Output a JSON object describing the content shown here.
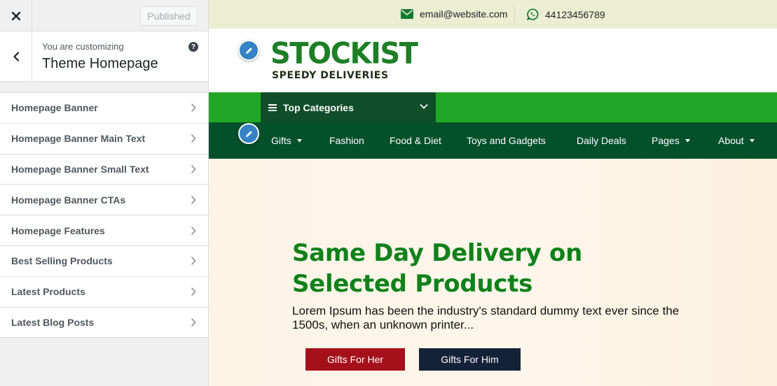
{
  "sidebar": {
    "close_icon": "close-icon",
    "publish_label": "Published",
    "info": {
      "customizing_label": "You are customizing",
      "title": "Theme Homepage",
      "help_label": "?"
    },
    "items": [
      {
        "label": "Homepage Banner"
      },
      {
        "label": "Homepage Banner Main Text"
      },
      {
        "label": "Homepage Banner Small Text"
      },
      {
        "label": "Homepage Banner CTAs"
      },
      {
        "label": "Homepage Features"
      },
      {
        "label": "Best Selling Products"
      },
      {
        "label": "Latest Products"
      },
      {
        "label": "Latest Blog Posts"
      }
    ]
  },
  "preview": {
    "topbar": {
      "email": "email@website.com",
      "phone": "44123456789",
      "email_icon": "envelope-icon",
      "phone_icon": "whatsapp-icon"
    },
    "logo": {
      "name": "STOCKIST",
      "tagline": "SPEEDY DELIVERIES"
    },
    "top_categories_label": "Top Categories",
    "nav": [
      {
        "label": "Gifts",
        "dropdown": true
      },
      {
        "label": "Fashion",
        "dropdown": false
      },
      {
        "label": "Food & Diet",
        "dropdown": false
      },
      {
        "label": "Toys and Gadgets",
        "dropdown": false
      },
      {
        "label": "Daily Deals",
        "dropdown": false
      },
      {
        "label": "Pages",
        "dropdown": true
      },
      {
        "label": "About",
        "dropdown": true
      }
    ],
    "hero": {
      "title": "Same Day Delivery on Selected Products",
      "text": "Lorem Ipsum has been the industry's standard dummy text ever since the 1500s, when an unknown printer...",
      "cta_primary": "Gifts For Her",
      "cta_secondary": "Gifts For Him"
    }
  },
  "colors": {
    "brand_green": "#1e7f26",
    "category_bar": "#21a725",
    "nav_bar": "#03502a",
    "cta_primary": "#a5101a",
    "cta_secondary": "#142238",
    "edit_shortcut": "#3582c4"
  }
}
